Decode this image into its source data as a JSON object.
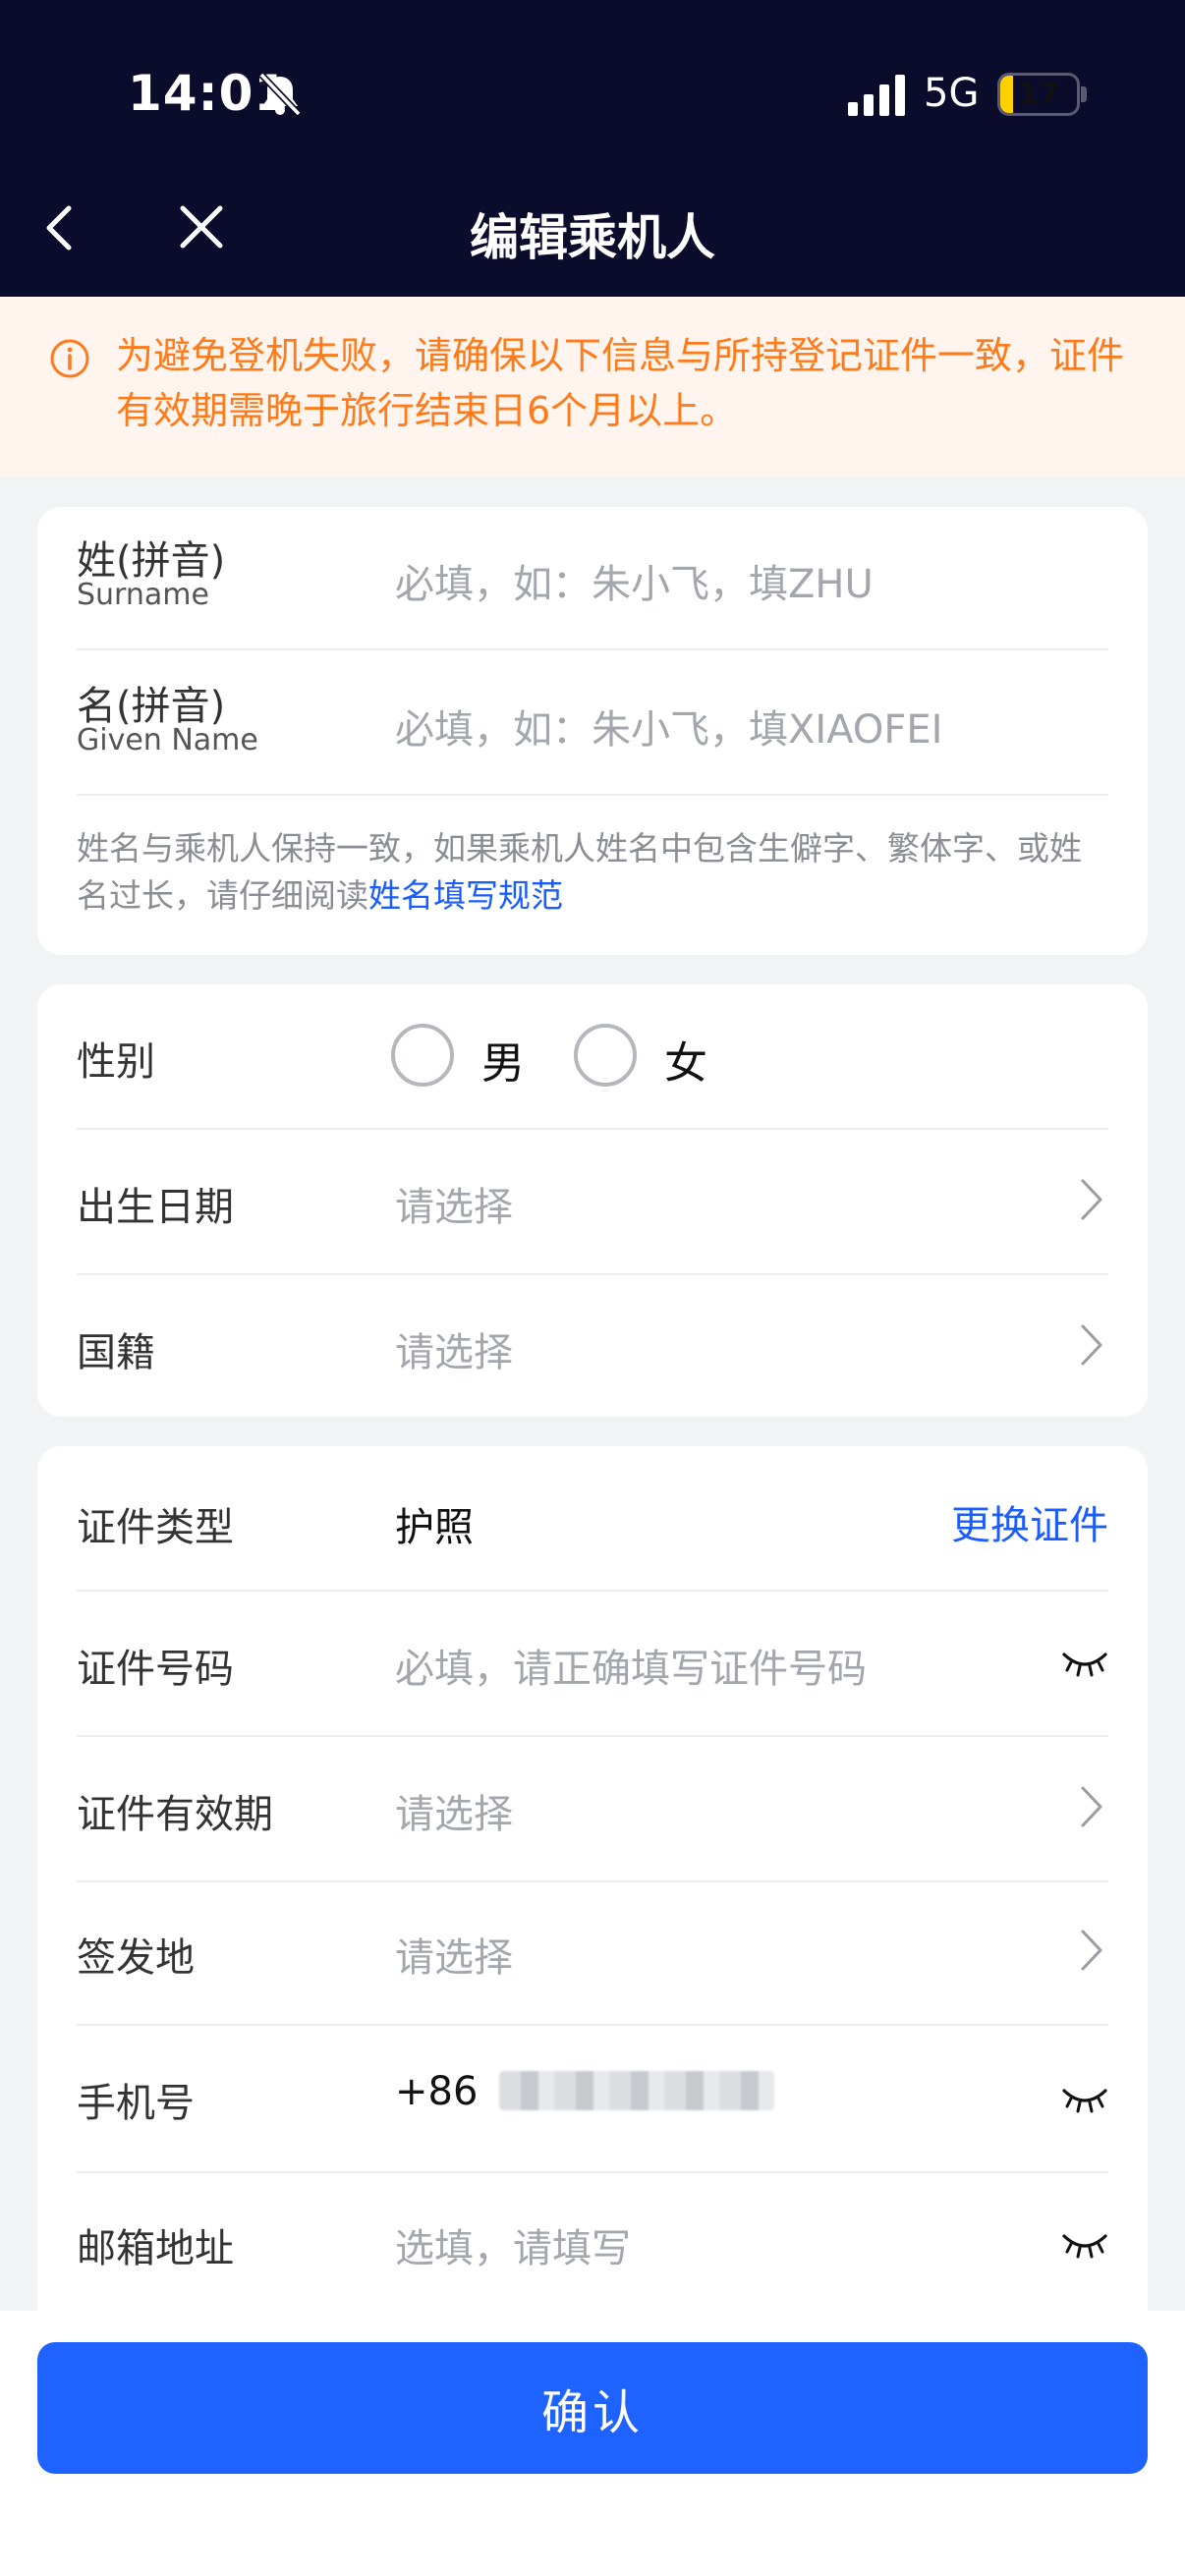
{
  "status_bar": {
    "time": "14:01",
    "network": "5G",
    "battery": "17",
    "battery_level": 0.17
  },
  "nav": {
    "title": "编辑乘机人"
  },
  "notice": {
    "text": "为避免登机失败，请确保以下信息与所持登记证件一致，证件有效期需晚于旅行结束日6个月以上。"
  },
  "name_card": {
    "surname": {
      "label": "姓(拼音)",
      "label_en": "Surname",
      "placeholder": "必填，如：朱小飞，填ZHU"
    },
    "given_name": {
      "label": "名(拼音)",
      "label_en": "Given Name",
      "placeholder": "必填，如：朱小飞，填XIAOFEI"
    },
    "hint": "姓名与乘机人保持一致，如果乘机人姓名中包含生僻字、繁体字、或姓名过长，请仔细阅读",
    "hint_link": "姓名填写规范"
  },
  "info_card": {
    "gender": {
      "label": "性别",
      "options": [
        "男",
        "女"
      ]
    },
    "birthday": {
      "label": "出生日期",
      "placeholder": "请选择"
    },
    "nationality": {
      "label": "国籍",
      "placeholder": "请选择"
    }
  },
  "id_card": {
    "id_type": {
      "label": "证件类型",
      "value": "护照",
      "action": "更换证件"
    },
    "id_number": {
      "label": "证件号码",
      "placeholder": "必填，请正确填写证件号码"
    },
    "validity": {
      "label": "证件有效期",
      "placeholder": "请选择"
    },
    "issue_place": {
      "label": "签发地",
      "placeholder": "请选择"
    },
    "phone": {
      "label": "手机号",
      "country_code": "+86"
    },
    "email": {
      "label": "邮箱地址",
      "placeholder": "选填，请填写"
    }
  },
  "footer": {
    "confirm_label": "确认"
  },
  "colors": {
    "header_bg": "#0b0b2c",
    "notice_text": "#ff7a1a",
    "link": "#1a5cff",
    "primary": "#1e62ff"
  },
  "icons": [
    "bell-off-icon",
    "signal-icon",
    "battery-icon",
    "back-icon",
    "close-icon",
    "info-icon",
    "chevron-right-icon",
    "eye-closed-icon"
  ]
}
